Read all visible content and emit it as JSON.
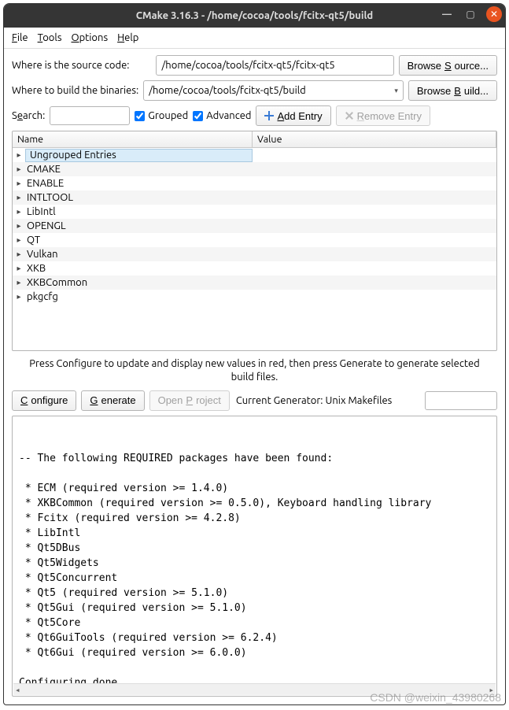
{
  "window": {
    "title": "CMake 3.16.3 - /home/cocoa/tools/fcitx-qt5/build"
  },
  "menus": {
    "file": "File",
    "tools": "Tools",
    "options": "Options",
    "help": "Help"
  },
  "labels": {
    "source": "Where is the source code:",
    "build": "Where to build the binaries:",
    "browse_source": "Browse Source...",
    "browse_build": "Browse Build...",
    "search": "Search:",
    "grouped": "Grouped",
    "advanced": "Advanced",
    "add_entry": "Add Entry",
    "remove_entry": "Remove Entry",
    "name_col": "Name",
    "value_col": "Value",
    "help": "Press Configure to update and display new values in red, then press Generate to generate selected build files.",
    "configure": "Configure",
    "generate": "Generate",
    "open_project": "Open Project",
    "current_generator": "Current Generator: Unix Makefiles"
  },
  "paths": {
    "source": "/home/cocoa/tools/fcitx-qt5/fcitx-qt5",
    "build": "/home/cocoa/tools/fcitx-qt5/build"
  },
  "checkboxes": {
    "grouped": true,
    "advanced": true
  },
  "tree": [
    {
      "label": "Ungrouped Entries",
      "selected": true
    },
    {
      "label": "CMAKE"
    },
    {
      "label": "ENABLE"
    },
    {
      "label": "INTLTOOL"
    },
    {
      "label": "LibIntl"
    },
    {
      "label": "OPENGL"
    },
    {
      "label": "QT"
    },
    {
      "label": "Vulkan"
    },
    {
      "label": "XKB"
    },
    {
      "label": "XKBCommon"
    },
    {
      "label": "pkgcfg"
    }
  ],
  "log": "\n-- The following REQUIRED packages have been found:\n\n * ECM (required version >= 1.4.0)\n * XKBCommon (required version >= 0.5.0), Keyboard handling library\n * Fcitx (required version >= 4.2.8)\n * LibIntl\n * Qt5DBus\n * Qt5Widgets\n * Qt5Concurrent\n * Qt5 (required version >= 5.1.0)\n * Qt5Gui (required version >= 5.1.0)\n * Qt5Core\n * Qt6GuiTools (required version >= 6.2.4)\n * Qt6Gui (required version >= 6.0.0)\n\nConfiguring done",
  "watermark": "CSDN @weixin_43980268"
}
